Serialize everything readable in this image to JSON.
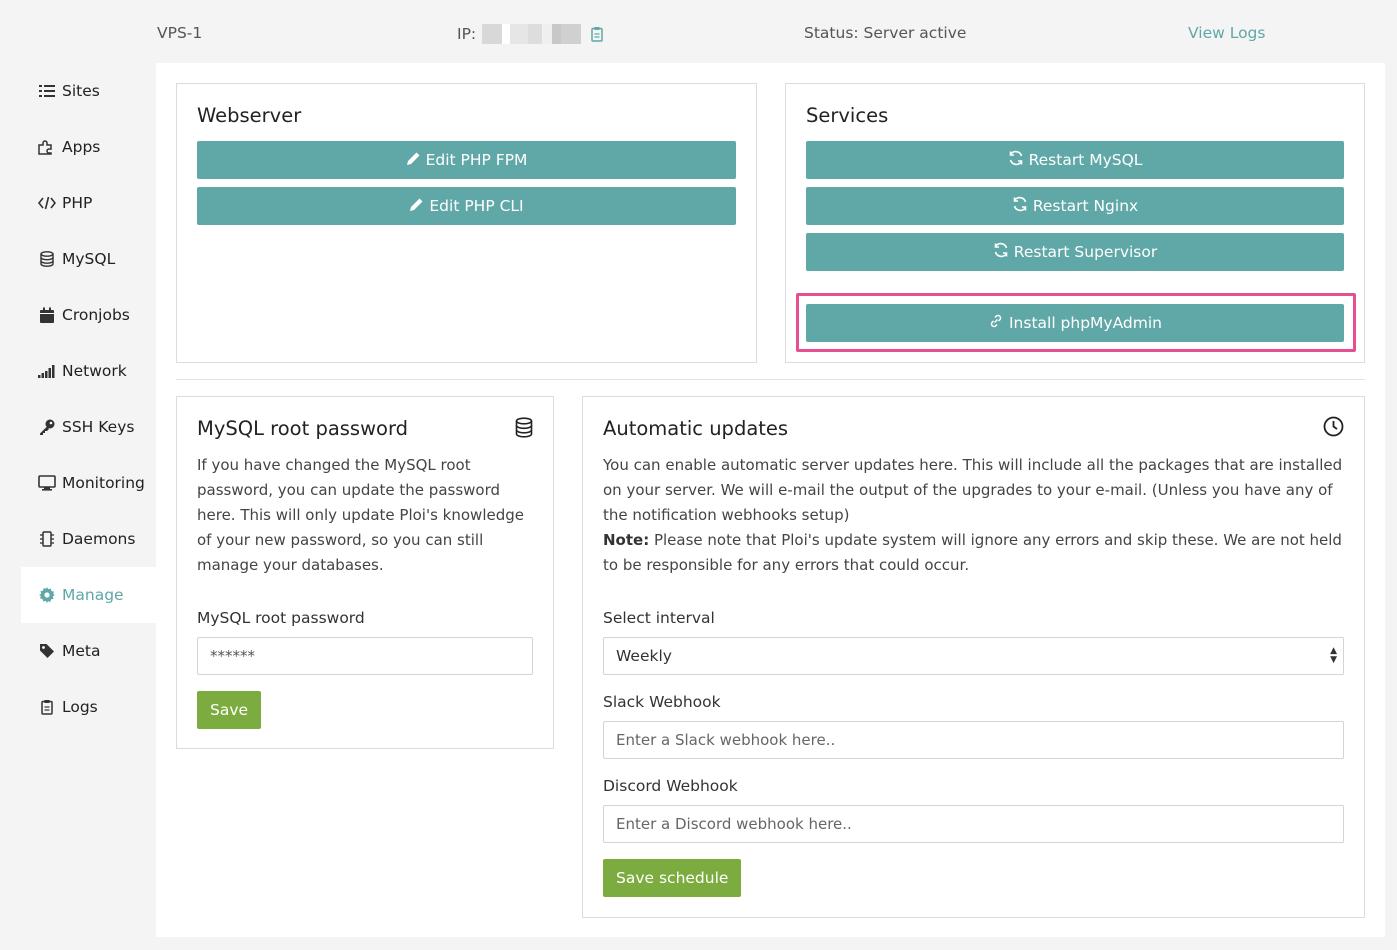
{
  "header": {
    "server_name": "VPS-1",
    "ip_label": "IP:",
    "status": "Status: Server active",
    "view_logs": "View Logs"
  },
  "sidebar": {
    "items": [
      {
        "label": "Sites",
        "icon": "list-icon"
      },
      {
        "label": "Apps",
        "icon": "puzzle-icon"
      },
      {
        "label": "PHP",
        "icon": "code-icon"
      },
      {
        "label": "MySQL",
        "icon": "database-icon"
      },
      {
        "label": "Cronjobs",
        "icon": "calendar-icon"
      },
      {
        "label": "Network",
        "icon": "signal-icon"
      },
      {
        "label": "SSH Keys",
        "icon": "key-icon"
      },
      {
        "label": "Monitoring",
        "icon": "desktop-icon"
      },
      {
        "label": "Daemons",
        "icon": "daemon-icon"
      },
      {
        "label": "Manage",
        "icon": "gear-icon",
        "active": true
      },
      {
        "label": "Meta",
        "icon": "tag-icon"
      },
      {
        "label": "Logs",
        "icon": "clipboard-icon"
      }
    ]
  },
  "webserver": {
    "title": "Webserver",
    "edit_fpm": "Edit PHP FPM",
    "edit_cli": "Edit PHP CLI"
  },
  "services": {
    "title": "Services",
    "restart_mysql": "Restart MySQL",
    "restart_nginx": "Restart Nginx",
    "restart_supervisor": "Restart Supervisor",
    "install_phpmyadmin": "Install phpMyAdmin"
  },
  "mysql_password": {
    "title": "MySQL root password",
    "description": "If you have changed the MySQL root password, you can update the password here. This will only update Ploi's knowledge of your new password, so you can still manage your databases.",
    "field_label": "MySQL root password",
    "field_value": "******",
    "save": "Save"
  },
  "auto_updates": {
    "title": "Automatic updates",
    "description": "You can enable automatic server updates here. This will include all the packages that are installed on your server. We will e-mail the output of the upgrades to your e-mail. (Unless you have any of the notification webhooks setup)",
    "note_label": "Note:",
    "note_text": " Please note that Ploi's update system will ignore any errors and skip these. We are not held to be responsible for any errors that could occur.",
    "interval_label": "Select interval",
    "interval_value": "Weekly",
    "slack_label": "Slack Webhook",
    "slack_placeholder": "Enter a Slack webhook here..",
    "discord_label": "Discord Webhook",
    "discord_placeholder": "Enter a Discord webhook here..",
    "save": "Save schedule"
  },
  "colors": {
    "accent": "#5fa8a7",
    "success": "#7cac3f",
    "highlight": "#e64f8f"
  }
}
